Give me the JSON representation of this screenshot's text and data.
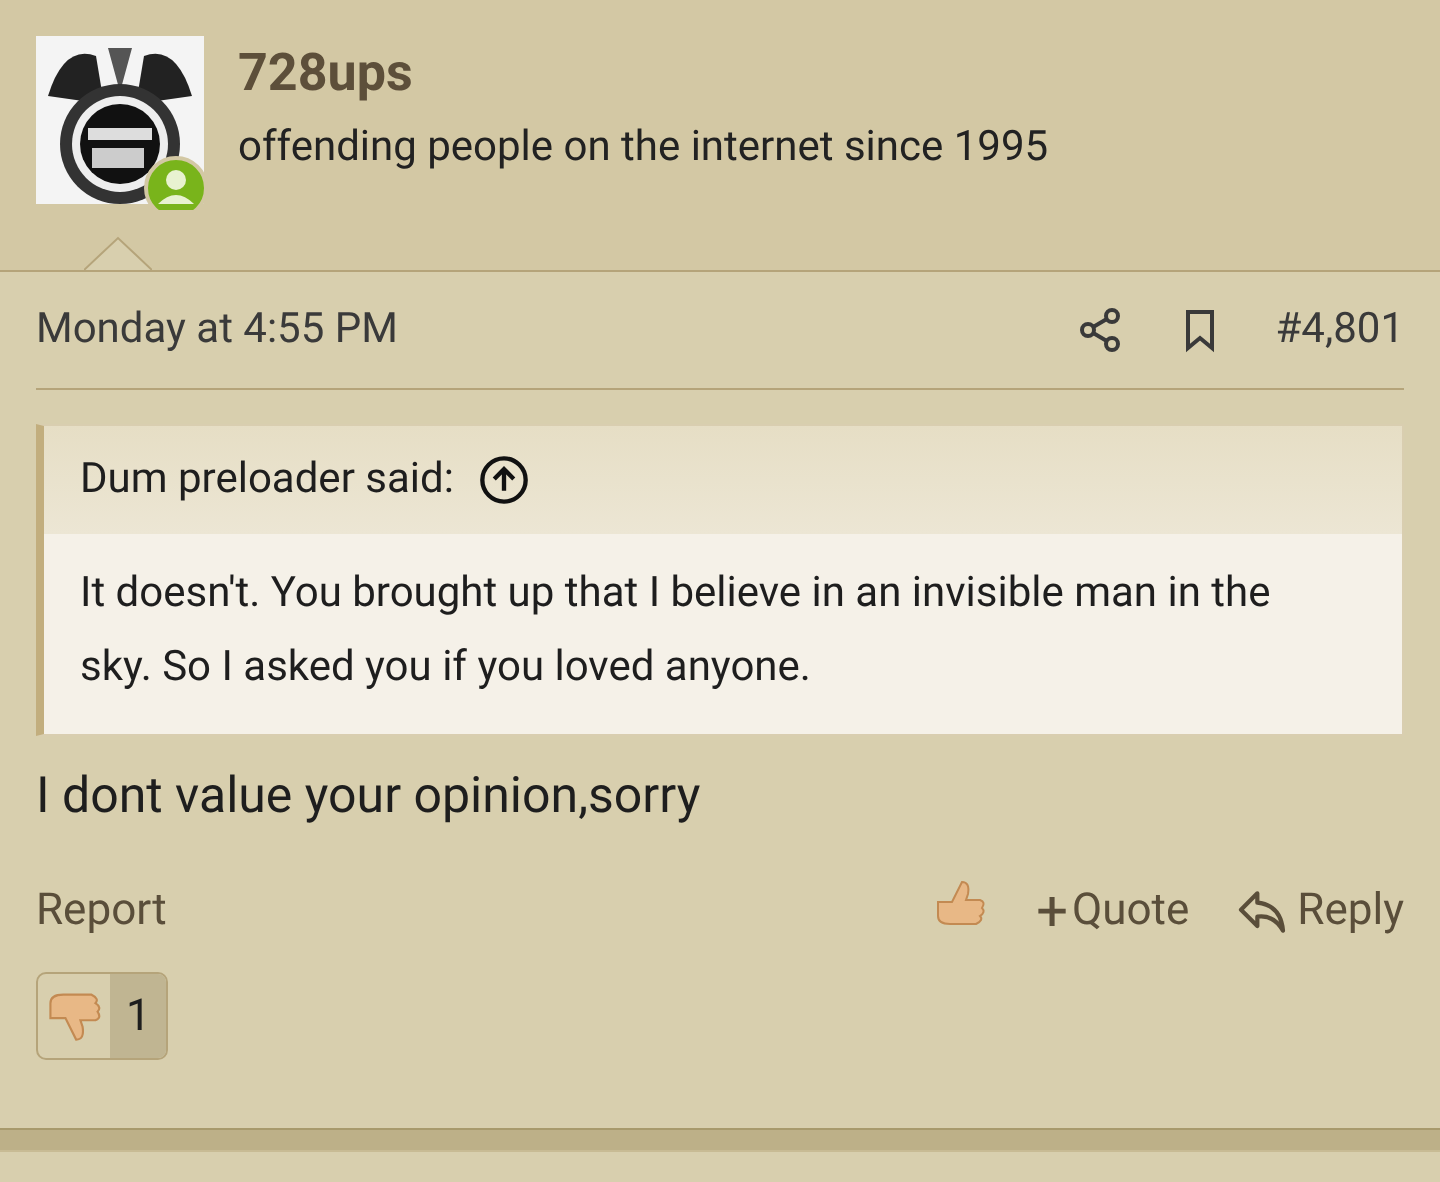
{
  "user": {
    "name": "728ups",
    "tagline": "offending people on the internet since 1995",
    "online": true
  },
  "post": {
    "date": "Monday at 4:55 PM",
    "number": "#4,801",
    "quote": {
      "attribution": "Dum preloader said:",
      "text": "It doesn't. You brought up that I believe in an invisible man in the sky. So I asked you if you loved anyone."
    },
    "body": "I dont value your opinion,sorry",
    "actions": {
      "report": "Report",
      "quote": "Quote",
      "quote_sign": "+",
      "reply": "Reply"
    },
    "reactions": [
      {
        "count": "1"
      }
    ]
  }
}
